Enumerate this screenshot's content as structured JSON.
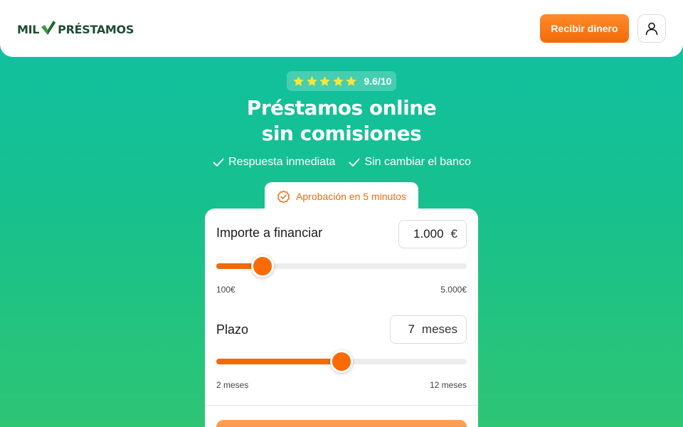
{
  "header": {
    "logo_left": "MIL",
    "logo_right": "PRÉSTAMOS",
    "cta_label": "Recibir dinero",
    "user_icon": "user-icon"
  },
  "colors": {
    "accent": "#f26a0a",
    "brand_green": "#1f4d33",
    "background_top": "#0fc0a4",
    "background_bottom": "#2ec574",
    "star": "#f5e63a"
  },
  "rating": {
    "stars": 5,
    "value": "9.6/10"
  },
  "hero": {
    "title_line1": "Préstamos online",
    "title_line2": "sin comisiones",
    "benefits": [
      {
        "icon": "check-icon",
        "label": "Respuesta inmediata"
      },
      {
        "icon": "check-icon",
        "label": "Sin cambiar el banco"
      }
    ]
  },
  "approval_tab": {
    "icon": "check-circle-icon",
    "label": "Aprobación en 5 minutos"
  },
  "calculator": {
    "amount": {
      "label": "Importe a financiar",
      "value": "1.000",
      "unit": "€",
      "slider_value": 1000,
      "min_label": "100€",
      "max_label": "5.000€",
      "min": 100,
      "max": 5000
    },
    "term": {
      "label": "Plazo",
      "value": "7",
      "unit": "meses",
      "slider_value": 7,
      "min_label": "2 meses",
      "max_label": "12 meses",
      "min": 2,
      "max": 12
    }
  }
}
